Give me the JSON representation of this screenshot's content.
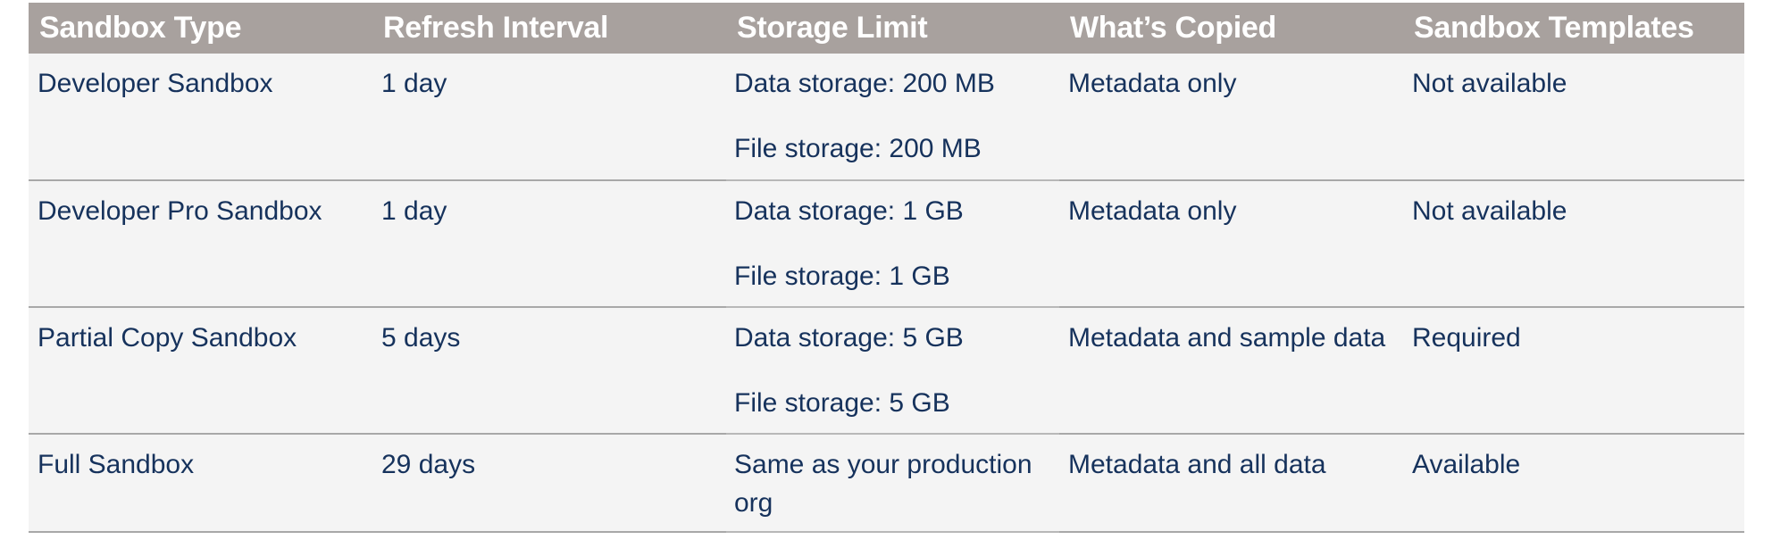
{
  "headers": [
    "Sandbox Type",
    "Refresh Interval",
    "Storage Limit",
    "What’s Copied",
    "Sandbox Templates"
  ],
  "rows": [
    {
      "type": "Developer Sandbox",
      "refresh": "1 day",
      "storage": [
        "Data storage: 200 MB",
        "File storage: 200 MB"
      ],
      "copied": "Metadata only",
      "templates": "Not available"
    },
    {
      "type": "Developer Pro Sandbox",
      "refresh": "1 day",
      "storage": [
        "Data storage: 1 GB",
        "File storage: 1 GB"
      ],
      "copied": "Metadata only",
      "templates": "Not available"
    },
    {
      "type": "Partial Copy Sandbox",
      "refresh": "5 days",
      "storage": [
        "Data storage: 5 GB",
        "File storage: 5 GB"
      ],
      "copied": "Metadata and sample data",
      "templates": "Required"
    },
    {
      "type": "Full Sandbox",
      "refresh": "29 days",
      "storage": [
        "Same as your production org"
      ],
      "copied": "Metadata and all data",
      "templates": "Available"
    }
  ],
  "colors": {
    "header_bg": "#a8a19e",
    "header_text": "#ffffff",
    "row_bg": "#f4f4f4",
    "body_text": "#16325c",
    "divider": "#a8a8a8"
  }
}
